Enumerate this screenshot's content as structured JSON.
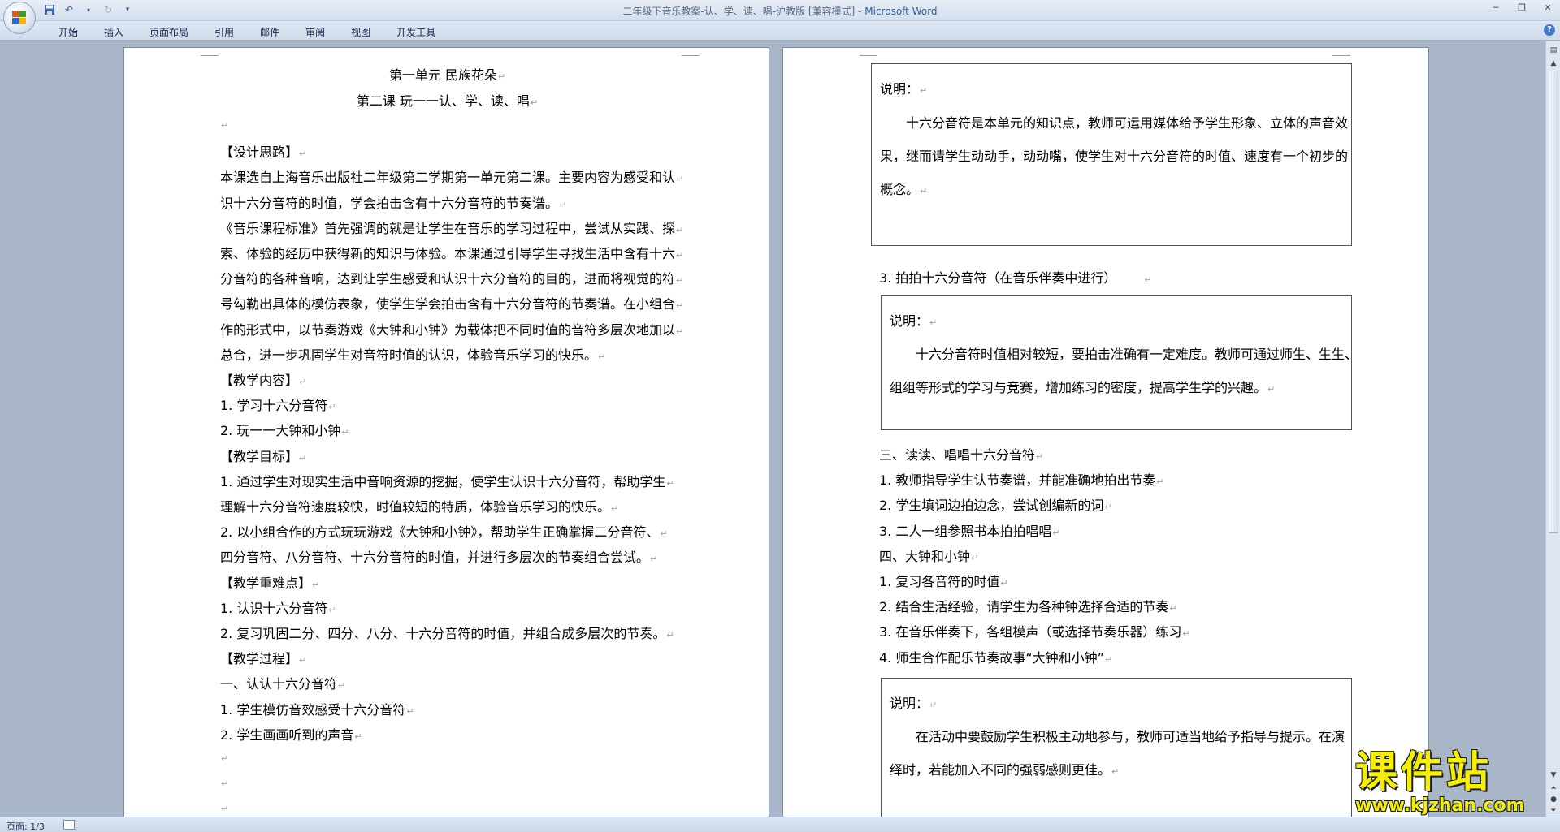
{
  "window": {
    "title": "二年级下音乐教案-认、学、读、唱-沪教版 [兼容模式] - ",
    "app_name": "Microsoft Word"
  },
  "ribbon": {
    "tabs": [
      "开始",
      "插入",
      "页面布局",
      "引用",
      "邮件",
      "审阅",
      "视图",
      "开发工具"
    ]
  },
  "page_left": {
    "title1": "第一单元      民族花朵",
    "title2": "第二课      玩一一认、学、读、唱",
    "lines": [
      "",
      "【设计思路】",
      "本课选自上海音乐出版社二年级第二学期第一单元第二课。主要内容为感受和认",
      "识十六分音符的时值，学会拍击含有十六分音符的节奏谱。",
      "《音乐课程标准》首先强调的就是让学生在音乐的学习过程中，尝试从实践、探",
      "索、体验的经历中获得新的知识与体验。本课通过引导学生寻找生活中含有十六",
      "分音符的各种音响，达到让学生感受和认识十六分音符的目的，进而将视觉的符",
      "号勾勒出具体的模仿表象，使学生学会拍击含有十六分音符的节奏谱。在小组合",
      "作的形式中，以节奏游戏《大钟和小钟》为载体把不同时值的音符多层次地加以",
      "总合，进一步巩固学生对音符时值的认识，体验音乐学习的快乐。",
      "【教学内容】",
      "1.  学习十六分音符",
      "2.  玩一一大钟和小钟",
      "【教学目标】",
      "1.  通过学生对现实生活中音响资源的挖掘，使学生认识十六分音符，帮助学生",
      "理解十六分音符速度较快，时值较短的特质，体验音乐学习的快乐。",
      "2.  以小组合作的方式玩玩游戏《大钟和小钟》，帮助学生正确掌握二分音符、",
      "四分音符、八分音符、十六分音符的时值，并进行多层次的节奏组合尝试。",
      "【教学重难点】",
      "1.  认识十六分音符",
      "2.  复习巩固二分、四分、八分、十六分音符的时值，并组合成多层次的节奏。",
      "【教学过程】",
      "一、认认十六分音符",
      "1.  学生模仿音效感受十六分音符",
      "2.  学生画画听到的声音",
      "",
      "",
      ""
    ]
  },
  "page_right": {
    "note1": {
      "label": "说明：",
      "lines": [
        "十六分音符是本单元的知识点，教师可运用媒体给予学生形象、立体的声音效",
        "果，继而请学生动动手，动动嘴，使学生对十六分音符的时值、速度有一个初步的",
        "概念。"
      ]
    },
    "step3": "3.  拍拍十六分音符（在音乐伴奏中进行）",
    "note2": {
      "label": "说明：",
      "lines": [
        "十六分音符时值相对较短，要拍击准确有一定难度。教师可通过师生、生生、",
        "组组等形式的学习与竞赛，增加练习的密度，提高学生学的兴趣。"
      ]
    },
    "lines": [
      "三、读读、唱唱十六分音符",
      "1.  教师指导学生认节奏谱，并能准确地拍出节奏",
      "2.  学生填词边拍边念，尝试创编新的词",
      "3.  二人一组参照书本拍拍唱唱",
      "四、大钟和小钟",
      "1.  复习各音符的时值",
      "2.  结合生活经验，请学生为各种钟选择合适的节奏",
      "3.  在音乐伴奏下，各组模声（或选择节奏乐器）练习",
      "4.  师生合作配乐节奏故事“大钟和小钟”"
    ],
    "note3": {
      "label": "说明：",
      "lines": [
        "在活动中要鼓励学生积极主动地参与，教师可适当地给予指导与提示。在演",
        "绎时，若能加入不同的强弱感则更佳。"
      ]
    }
  },
  "statusbar": {
    "page": "页面: 1/3"
  },
  "watermark": {
    "top": "课件站",
    "bottom": "www.kjzhan.com"
  },
  "colors": {
    "title_app": "#2f5fa6",
    "background": "#a9b6c7",
    "watermark": "#f5f000"
  }
}
